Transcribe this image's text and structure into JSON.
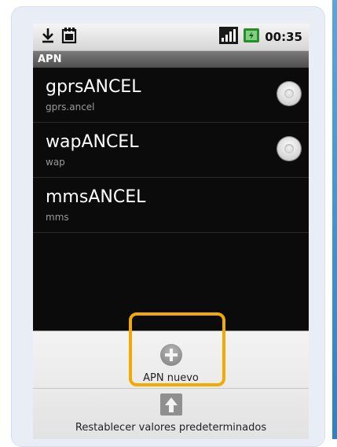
{
  "status_bar": {
    "time": "00:35",
    "icons": [
      "download-icon",
      "sd-card-icon",
      "signal-icon",
      "battery-icon"
    ]
  },
  "screen": {
    "title": "APN"
  },
  "apn_list": [
    {
      "name": "gprsANCEL",
      "sub": "gprs.ancel",
      "has_radio": true
    },
    {
      "name": "wapANCEL",
      "sub": "wap",
      "has_radio": true
    },
    {
      "name": "mmsANCEL",
      "sub": "mms",
      "has_radio": false
    }
  ],
  "menu": {
    "new_apn_label": "APN nuevo",
    "reset_label": "Restablecer valores predeterminados"
  },
  "colors": {
    "highlight": "#f2a900",
    "side_rail": "#3b8fd2",
    "list_background": "#0b0b0b"
  }
}
